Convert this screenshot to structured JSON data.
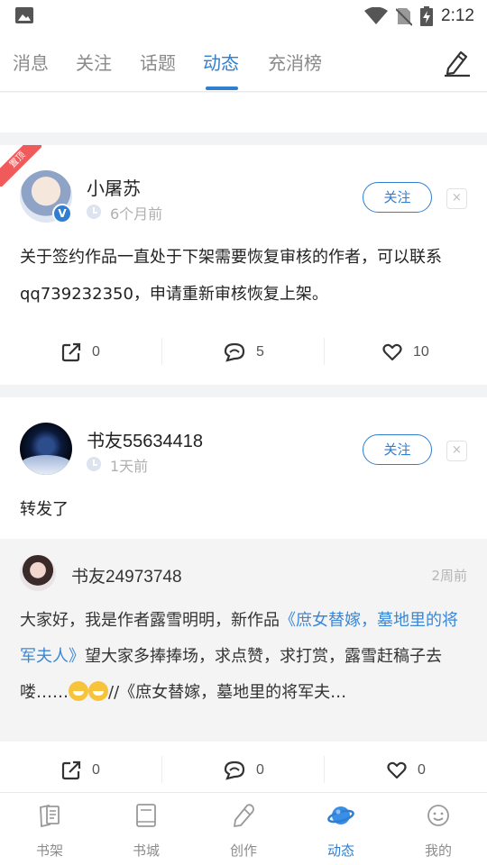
{
  "status_bar": {
    "time": "2:12"
  },
  "tabs": [
    {
      "label": "消息"
    },
    {
      "label": "关注"
    },
    {
      "label": "话题"
    },
    {
      "label": "动态",
      "active": true
    },
    {
      "label": "充消榜"
    }
  ],
  "posts": [
    {
      "pinned_label": "置顶",
      "author": "小屠苏",
      "verified_badge": "V",
      "time": "6个月前",
      "follow_label": "关注",
      "close_label": "×",
      "text": "关于签约作品一直处于下架需要恢复审核的作者，可以联系qq739232350，申请重新审核恢复上架。",
      "shares": "0",
      "comments": "5",
      "likes": "10"
    },
    {
      "author": "书友55634418",
      "time": "1天前",
      "follow_label": "关注",
      "close_label": "×",
      "text": "转发了",
      "quoted": {
        "author": "书友24973748",
        "time": "2周前",
        "text_before": "大家好，我是作者露雪明明，新作品",
        "link": "《庶女替嫁，墓地里的将军夫人》",
        "text_after": "望大家多捧捧场，求点赞，求打赏，露雪赶稿子去喽……",
        "text_tail": "//《庶女替嫁，墓地里的将军夫…"
      },
      "shares": "0",
      "comments": "0",
      "likes": "0"
    }
  ],
  "bottom_nav": [
    {
      "label": "书架",
      "icon": "bookshelf-icon"
    },
    {
      "label": "书城",
      "icon": "bookstore-icon"
    },
    {
      "label": "创作",
      "icon": "pen-icon"
    },
    {
      "label": "动态",
      "icon": "planet-icon",
      "active": true
    },
    {
      "label": "我的",
      "icon": "smiley-face-icon"
    }
  ],
  "colors": {
    "accent": "#2f7ed0",
    "pin_ribbon": "#f05a5a",
    "link": "#3a87d6"
  }
}
